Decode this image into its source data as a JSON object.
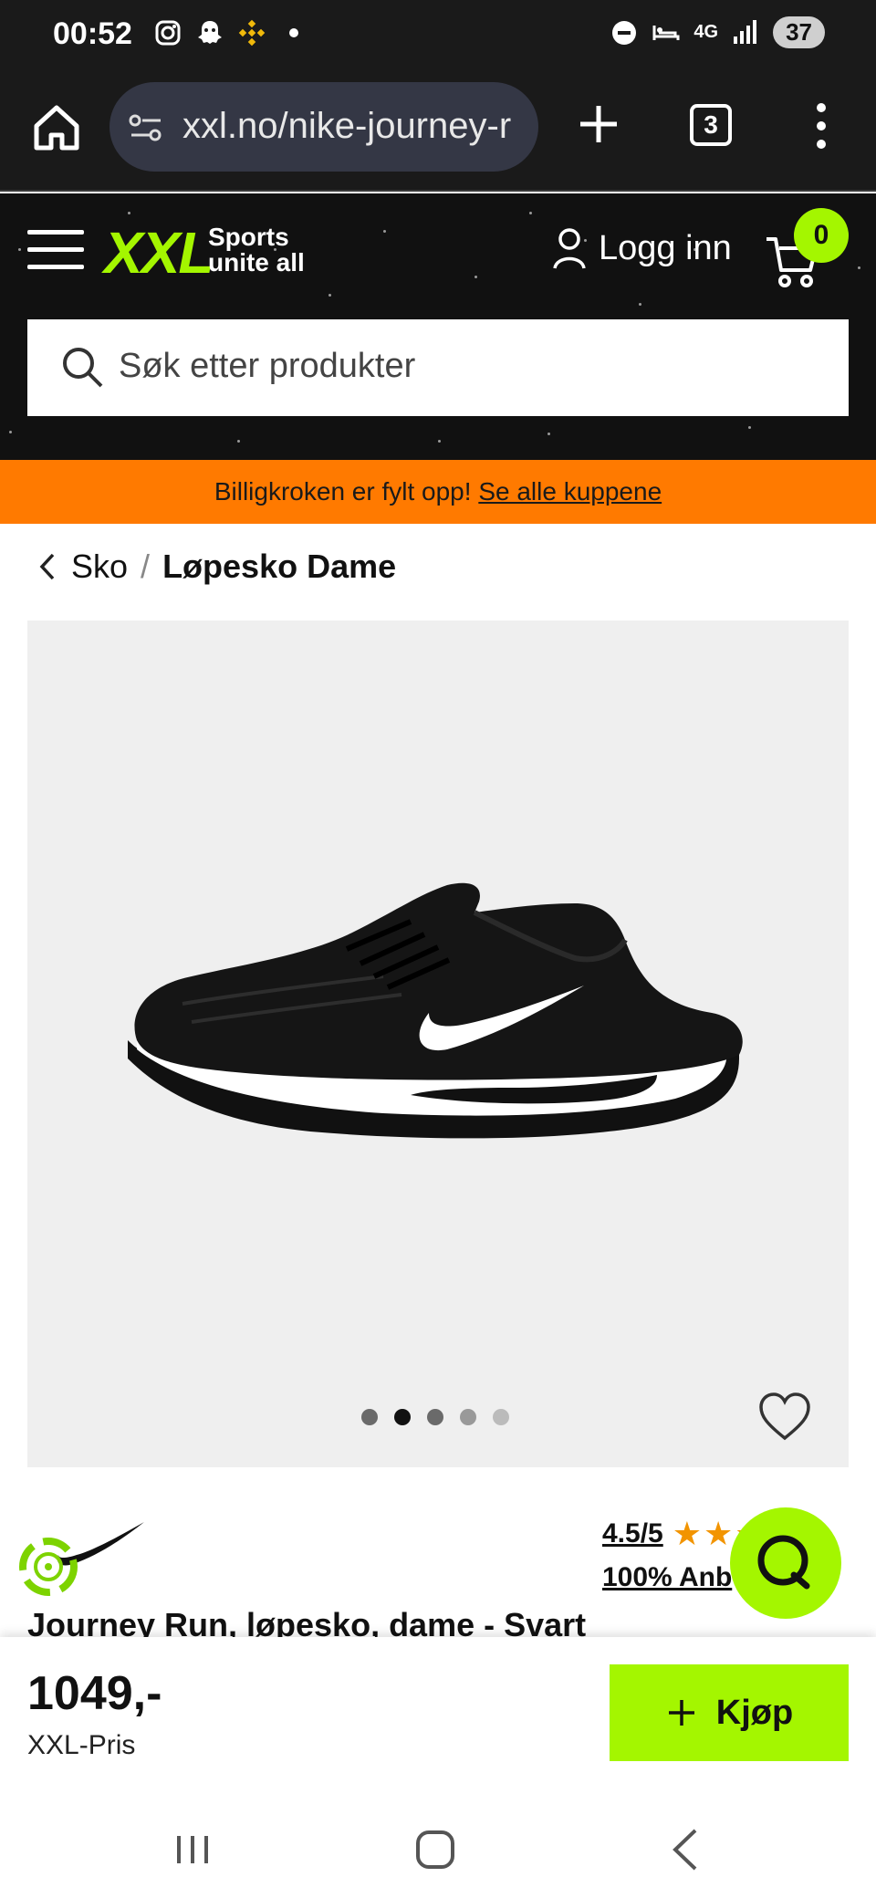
{
  "status_bar": {
    "time": "00:52",
    "network": "4G",
    "battery": "37",
    "icons_left": [
      "instagram-icon",
      "snapchat-icon",
      "binance-icon",
      "dot-icon"
    ],
    "icons_right": [
      "dnd-icon",
      "sleep-icon",
      "network-4g-icon",
      "signal-icon",
      "battery-icon"
    ]
  },
  "browser": {
    "url": "xxl.no/nike-journey-r",
    "tab_count": "3"
  },
  "header": {
    "logo": "XXL",
    "tagline_1": "Sports",
    "tagline_2": "unite all",
    "login_label": "Logg inn",
    "cart_count": "0",
    "search_placeholder": "Søk etter produkter"
  },
  "banner": {
    "text": "Billigkroken er fylt opp! ",
    "link": "Se alle kuppene",
    "color": "#ff7a00"
  },
  "breadcrumb": {
    "parent": "Sko",
    "separator": "/",
    "current": "Løpesko Dame"
  },
  "product": {
    "image_dots": 5,
    "active_dot": 2,
    "rating_score": "4.5/5",
    "rating_value": 4.5,
    "rating_max": 5,
    "recommend": "100% Anb",
    "title": "Journey Run, løpesko, dame - Svart"
  },
  "purchase": {
    "price": "1049,-",
    "price_label": "XXL-Pris",
    "buy_label": "Kjøp",
    "accent": "#a4f600"
  }
}
